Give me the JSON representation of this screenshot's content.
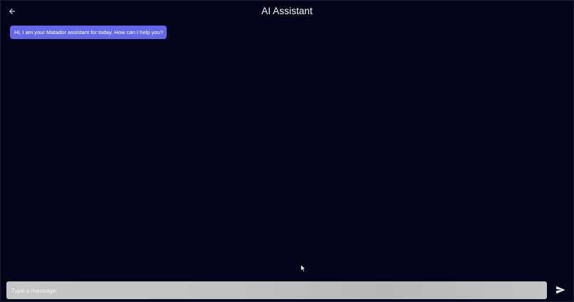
{
  "header": {
    "title": "AI Assistant",
    "back_icon": "arrow-left-icon"
  },
  "messages": [
    {
      "sender": "assistant",
      "text": "Hi, I am your Matador assistant for today. How can I help you?"
    }
  ],
  "composer": {
    "placeholder": "Type a message",
    "value": "",
    "send_icon": "send-icon"
  },
  "colors": {
    "background": "#03031a",
    "bubble": "#6467e8",
    "title_text": "#ffffff",
    "input_background": "#c2c2c2"
  }
}
